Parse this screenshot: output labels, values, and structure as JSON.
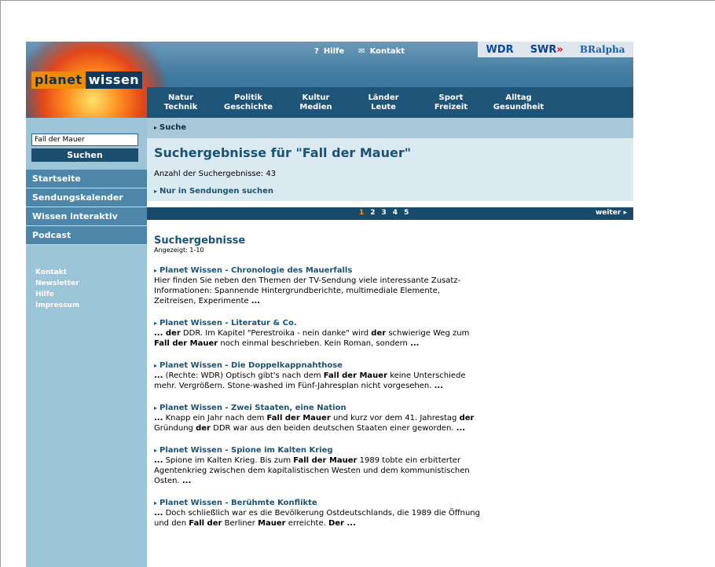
{
  "header": {
    "logo_part1": "planet",
    "logo_part2": "wissen",
    "help_label": "Hilfe",
    "contact_label": "Kontakt",
    "broadcasters": [
      "WDR",
      "SWR",
      "BRalpha"
    ],
    "nav": [
      {
        "line1": "Natur",
        "line2": "Technik"
      },
      {
        "line1": "Politik",
        "line2": "Geschichte"
      },
      {
        "line1": "Kultur",
        "line2": "Medien"
      },
      {
        "line1": "Länder",
        "line2": "Leute"
      },
      {
        "line1": "Sport",
        "line2": "Freizeit"
      },
      {
        "line1": "Alltag",
        "line2": "Gesundheit"
      }
    ]
  },
  "sidebar": {
    "search_value": "Fall der Mauer",
    "search_button": "Suchen",
    "menu": [
      "Startseite",
      "Sendungskalender",
      "Wissen interaktiv",
      "Podcast"
    ],
    "links": [
      "Kontakt",
      "Newsletter",
      "Hilfe",
      "Impressum"
    ]
  },
  "breadcrumb": "Suche",
  "results_header": {
    "title": "Suchergebnisse für \"Fall der Mauer\"",
    "count": "Anzahl der Suchergebnisse: 43",
    "only_in_shows": "Nur in Sendungen suchen"
  },
  "pager": {
    "pages": [
      "1",
      "2",
      "3",
      "4",
      "5"
    ],
    "current": "1",
    "next": "weiter"
  },
  "results": {
    "title": "Suchergebnisse",
    "shown": "Angezeigt: 1-10",
    "items": [
      {
        "title": "Planet Wissen - Chronologie des Mauerfalls",
        "snippet": [
          [
            "Hier finden Sie neben den Themen der TV-Sendung viele interessante Zusatz-Informationen: Spannende Hintergrundberichte, multimediale Elemente, Zeitreisen, Experimente ",
            false
          ],
          [
            "...",
            true
          ]
        ]
      },
      {
        "title": "Planet Wissen - Literatur & Co.",
        "snippet": [
          [
            "... der",
            true
          ],
          [
            " DDR. Im Kapitel \"Perestroika - nein danke\" wird ",
            false
          ],
          [
            "der",
            true
          ],
          [
            " schwierige Weg zum ",
            false
          ],
          [
            "Fall der Mauer",
            true
          ],
          [
            " noch einmal beschrieben. Kein Roman, sondern ",
            false
          ],
          [
            "...",
            true
          ]
        ]
      },
      {
        "title": "Planet Wissen - Die Doppelkappnahthose",
        "snippet": [
          [
            "...",
            true
          ],
          [
            " (Rechte: WDR) Optisch gibt's nach dem ",
            false
          ],
          [
            "Fall der Mauer",
            true
          ],
          [
            " keine Unterschiede mehr. Vergrößern. Stone-washed im Fünf-Jahresplan nicht vorgesehen. ",
            false
          ],
          [
            "...",
            true
          ]
        ]
      },
      {
        "title": "Planet Wissen - Zwei Staaten, eine Nation",
        "snippet": [
          [
            "...",
            true
          ],
          [
            " Knapp ein Jahr nach dem ",
            false
          ],
          [
            "Fall der Mauer",
            true
          ],
          [
            " und kurz vor dem 41. Jahrestag ",
            false
          ],
          [
            "der",
            true
          ],
          [
            " Gründung ",
            false
          ],
          [
            "der",
            true
          ],
          [
            " DDR war aus den beiden deutschen Staaten einer geworden. ",
            false
          ],
          [
            "...",
            true
          ]
        ]
      },
      {
        "title": "Planet Wissen - Spione im Kalten Krieg",
        "snippet": [
          [
            "...",
            true
          ],
          [
            " Spione im Kalten Krieg. Bis zum ",
            false
          ],
          [
            "Fall der Mauer",
            true
          ],
          [
            " 1989 tobte ein erbitterter Agentenkrieg zwischen dem kapitalistischen Westen und dem kommunistischen Osten. ",
            false
          ],
          [
            "...",
            true
          ]
        ]
      },
      {
        "title": "Planet Wissen - Berühmte Konflikte",
        "snippet": [
          [
            "...",
            true
          ],
          [
            " Doch schließlich war es die Bevölkerung Ostdeutschlands, die 1989 die Öffnung und den ",
            false
          ],
          [
            "Fall der",
            true
          ],
          [
            " Berliner ",
            false
          ],
          [
            "Mauer",
            true
          ],
          [
            " erreichte. ",
            false
          ],
          [
            "Der ...",
            true
          ]
        ]
      }
    ]
  },
  "colors": {
    "header_blue": "#3f7aa0",
    "nav_blue": "#1f5479",
    "sidebar_bg": "#9cc4d7",
    "link_blue": "#1b5375",
    "accent_orange": "#f08c00"
  }
}
